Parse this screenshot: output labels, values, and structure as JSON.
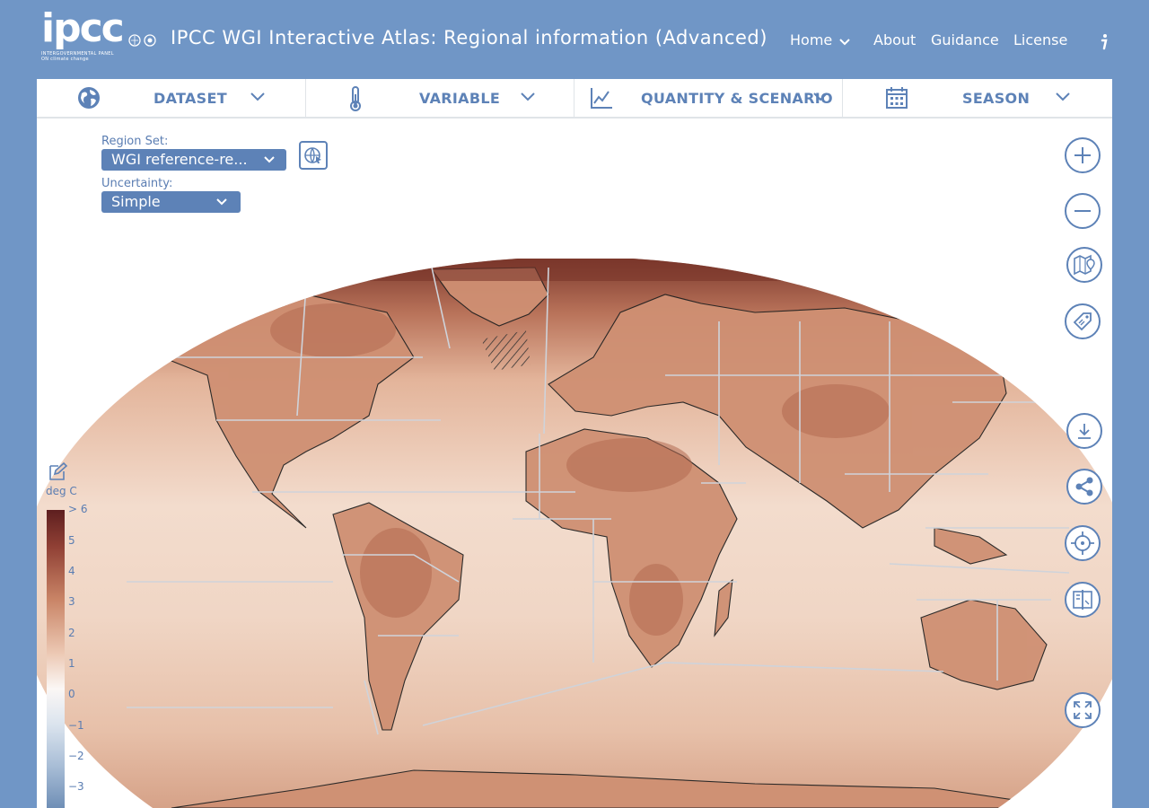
{
  "header": {
    "logo_text": "ipcc",
    "logo_subtext": "INTERGOVERNMENTAL PANEL ON climate change",
    "title": "IPCC WGI Interactive Atlas: Regional information (Advanced)",
    "nav": [
      {
        "label": "Home",
        "has_dropdown": true
      },
      {
        "label": "About"
      },
      {
        "label": "Guidance"
      },
      {
        "label": "License"
      }
    ],
    "info_icon": "info-icon"
  },
  "tabs": [
    {
      "label": "DATASET",
      "icon": "globe-icon"
    },
    {
      "label": "VARIABLE",
      "icon": "thermometer-icon"
    },
    {
      "label": "QUANTITY & SCENARIO",
      "icon": "line-chart-icon"
    },
    {
      "label": "SEASON",
      "icon": "calendar-icon"
    }
  ],
  "controls_panel": {
    "region_set_label": "Region Set:",
    "region_set_value": "WGI reference-re...",
    "uncertainty_label": "Uncertainty:",
    "uncertainty_value": "Simple"
  },
  "map_controls": [
    "zoom-in",
    "zoom-out",
    "map-layers",
    "region-labels",
    "download",
    "share",
    "locate",
    "compare",
    "fullscreen"
  ],
  "legend": {
    "unit": "deg C",
    "ticks": [
      "> 6",
      "5",
      "4",
      "3",
      "2",
      "1",
      "0",
      "−1",
      "−2",
      "−3"
    ]
  },
  "colors": {
    "brand_blue": "#7096c6",
    "accent_blue": "#5d82b7",
    "map_ocean": "#f1d8c8",
    "map_warm": "#b36f52",
    "map_hot": "#6e3128"
  }
}
